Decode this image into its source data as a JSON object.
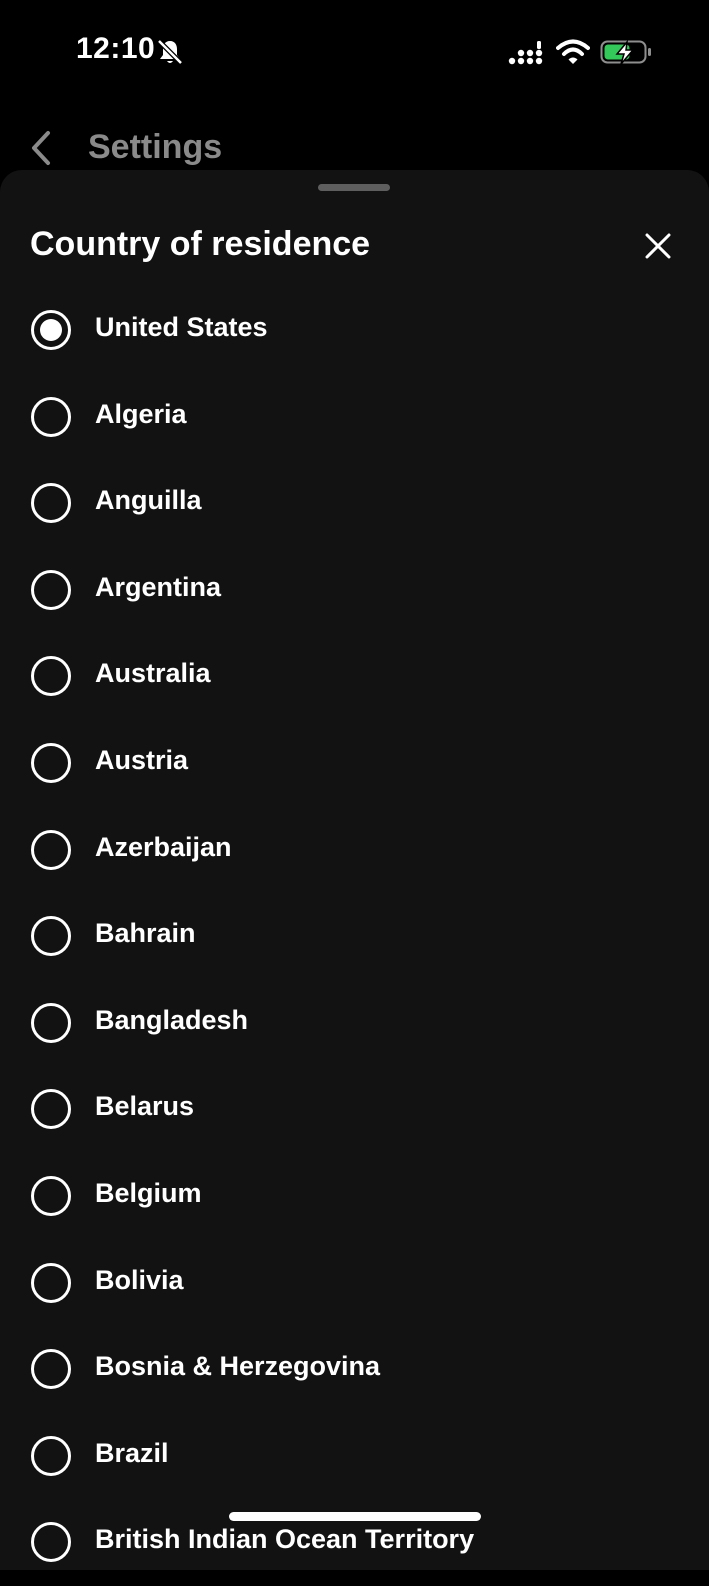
{
  "status_bar": {
    "time": "12:10",
    "battery_color": "#34c759"
  },
  "nav": {
    "back_title": "Settings"
  },
  "sheet": {
    "title": "Country of residence"
  },
  "countries": [
    {
      "label": "United States",
      "selected": true
    },
    {
      "label": "Algeria",
      "selected": false
    },
    {
      "label": "Anguilla",
      "selected": false
    },
    {
      "label": "Argentina",
      "selected": false
    },
    {
      "label": "Australia",
      "selected": false
    },
    {
      "label": "Austria",
      "selected": false
    },
    {
      "label": "Azerbaijan",
      "selected": false
    },
    {
      "label": "Bahrain",
      "selected": false
    },
    {
      "label": "Bangladesh",
      "selected": false
    },
    {
      "label": "Belarus",
      "selected": false
    },
    {
      "label": "Belgium",
      "selected": false
    },
    {
      "label": "Bolivia",
      "selected": false
    },
    {
      "label": "Bosnia & Herzegovina",
      "selected": false
    },
    {
      "label": "Brazil",
      "selected": false
    },
    {
      "label": "British Indian Ocean Territory",
      "selected": false
    }
  ]
}
